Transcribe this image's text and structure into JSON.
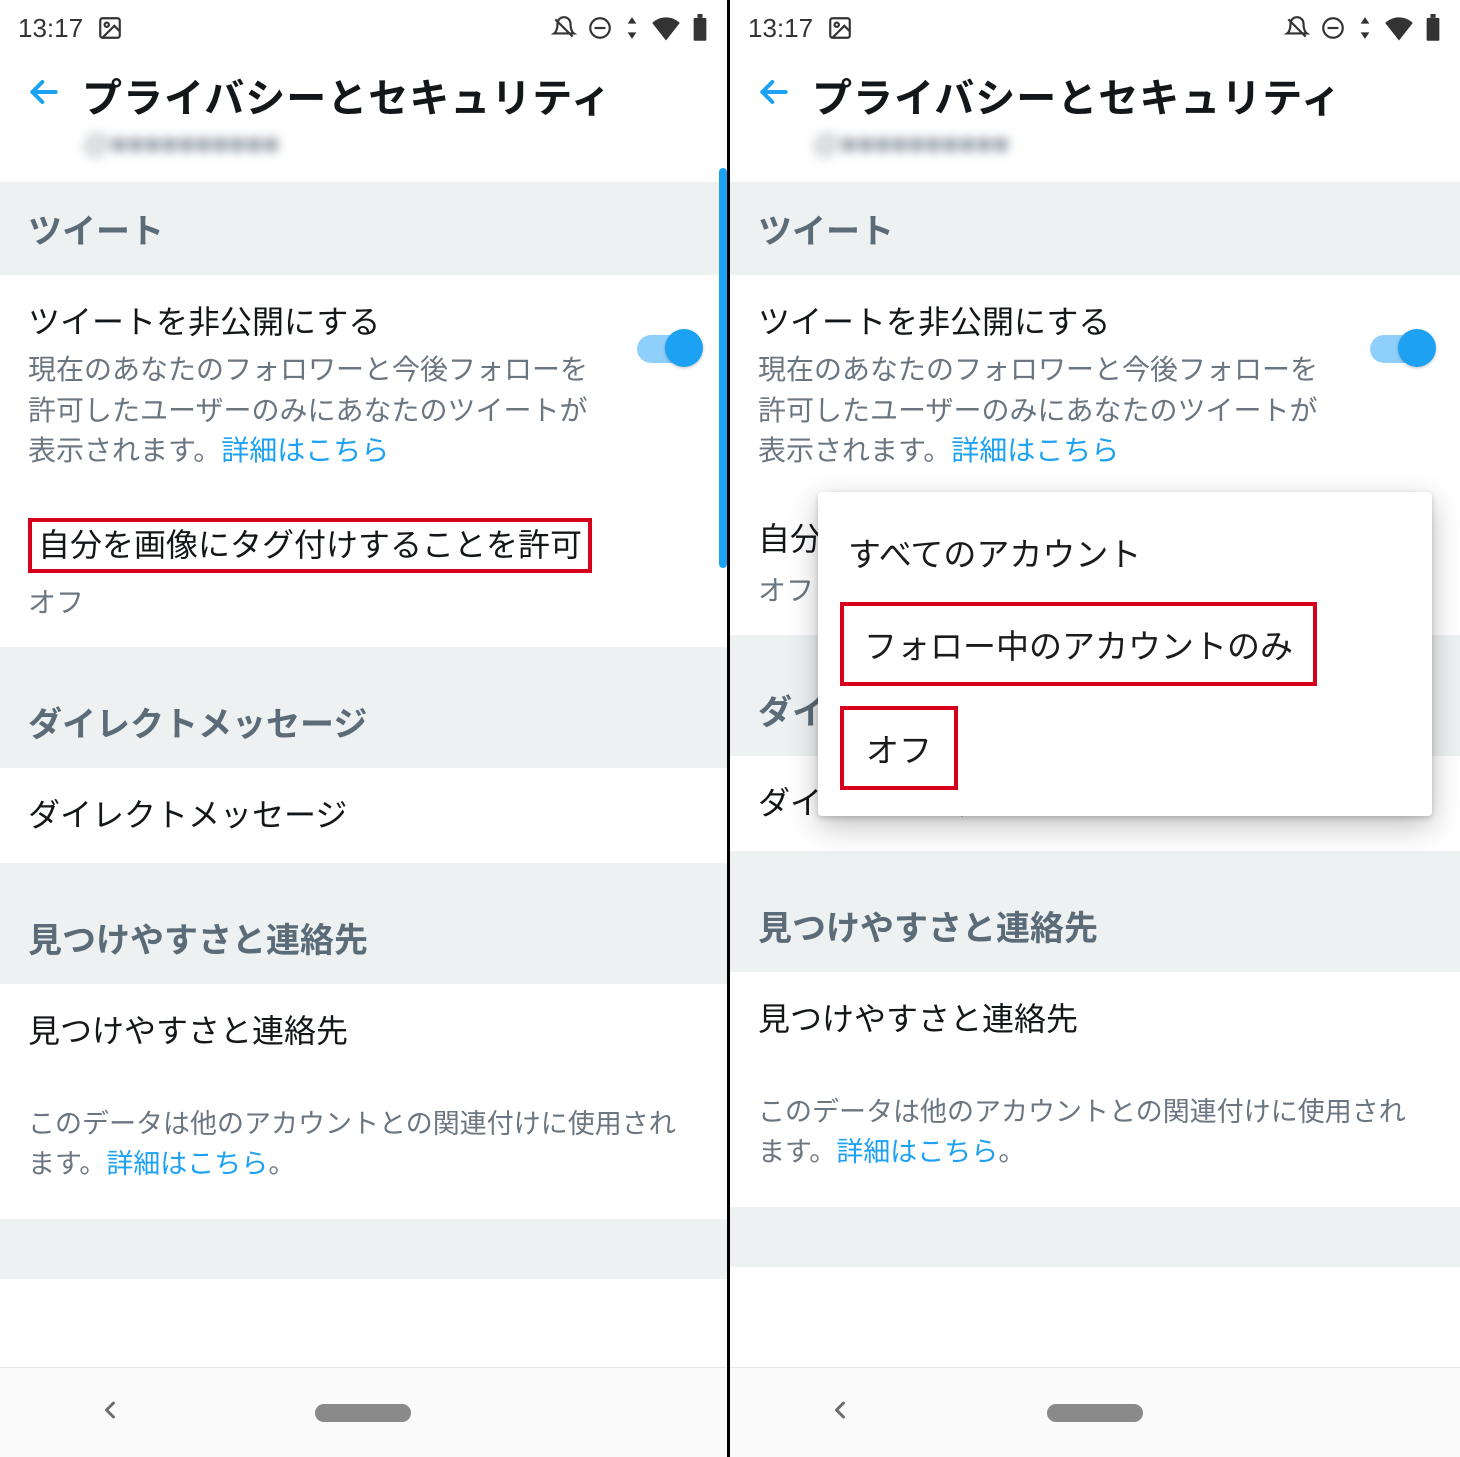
{
  "status": {
    "time": "13:17"
  },
  "header": {
    "title": "プライバシーとセキュリティ",
    "username": "@■■■■■■■■■■"
  },
  "sections": {
    "tweet_header": "ツイート",
    "dm_header": "ダイレクトメッセージ",
    "disc_header": "見つけやすさと連絡先"
  },
  "protect": {
    "title": "ツイートを非公開にする",
    "desc_a": "現在のあなたのフォロワーと今後フォローを許可したユーザーのみにあなたのツイートが表示されます。",
    "link": "詳細はこちら"
  },
  "tagging": {
    "title_full": "自分を画像にタグ付けすることを許可",
    "title_cut": "自分を画",
    "value": "オフ"
  },
  "dm_row": {
    "title": "ダイレクトメッセージ"
  },
  "disc_row": {
    "title": "見つけやすさと連絡先"
  },
  "disc_note": {
    "text_a": "このデータは他のアカウントとの関連付けに使用されます。",
    "link": "詳細はこちら",
    "dot": "。"
  },
  "popup": {
    "opt1": "すべてのアカウント",
    "opt2": "フォロー中のアカウントのみ",
    "opt3": "オフ"
  }
}
